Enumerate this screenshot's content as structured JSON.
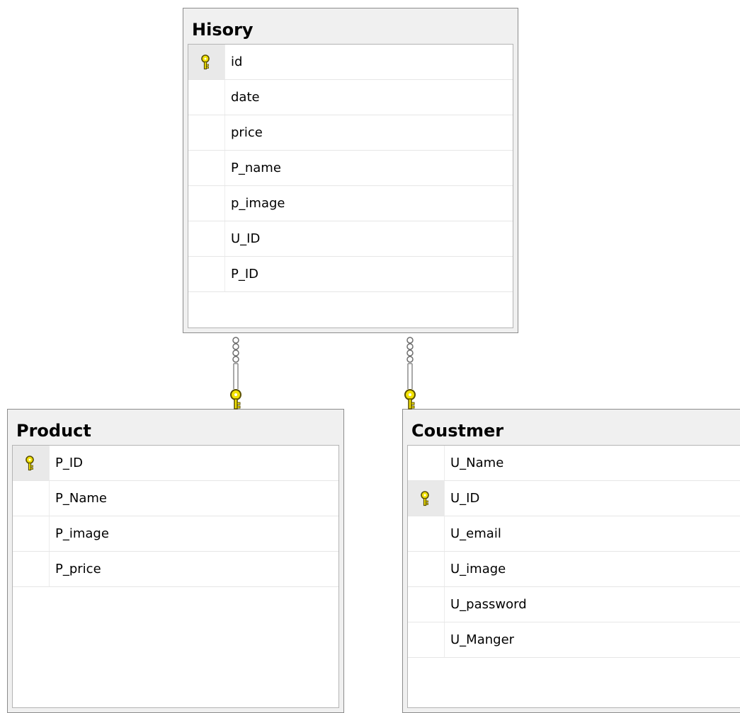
{
  "diagram": {
    "tables": [
      {
        "id": "history",
        "title": "Hisory",
        "columns": [
          {
            "name": "id",
            "primary_key": true
          },
          {
            "name": "date",
            "primary_key": false
          },
          {
            "name": "price",
            "primary_key": false
          },
          {
            "name": "P_name",
            "primary_key": false
          },
          {
            "name": "p_image",
            "primary_key": false
          },
          {
            "name": "U_ID",
            "primary_key": false
          },
          {
            "name": "P_ID",
            "primary_key": false
          }
        ]
      },
      {
        "id": "product",
        "title": "Product",
        "columns": [
          {
            "name": "P_ID",
            "primary_key": true
          },
          {
            "name": "P_Name",
            "primary_key": false
          },
          {
            "name": "P_image",
            "primary_key": false
          },
          {
            "name": "P_price",
            "primary_key": false
          }
        ]
      },
      {
        "id": "coustmer",
        "title": "Coustmer",
        "columns": [
          {
            "name": "U_Name",
            "primary_key": false
          },
          {
            "name": "U_ID",
            "primary_key": true
          },
          {
            "name": "U_email",
            "primary_key": false
          },
          {
            "name": "U_image",
            "primary_key": false
          },
          {
            "name": "U_password",
            "primary_key": false
          },
          {
            "name": "U_Manger",
            "primary_key": false
          }
        ]
      }
    ],
    "relationships": [
      {
        "from": "history",
        "to": "product",
        "from_end": "many",
        "to_end": "one"
      },
      {
        "from": "history",
        "to": "coustmer",
        "from_end": "many",
        "to_end": "one"
      }
    ],
    "colors": {
      "key_fill": "#f2e200",
      "key_outline": "#5a4f00",
      "border": "#8c8c8c",
      "header_bg": "#f0f0f0"
    },
    "icons": {
      "primary_key": "key-icon",
      "many_end": "infinity-icon",
      "one_end": "key-icon"
    }
  }
}
